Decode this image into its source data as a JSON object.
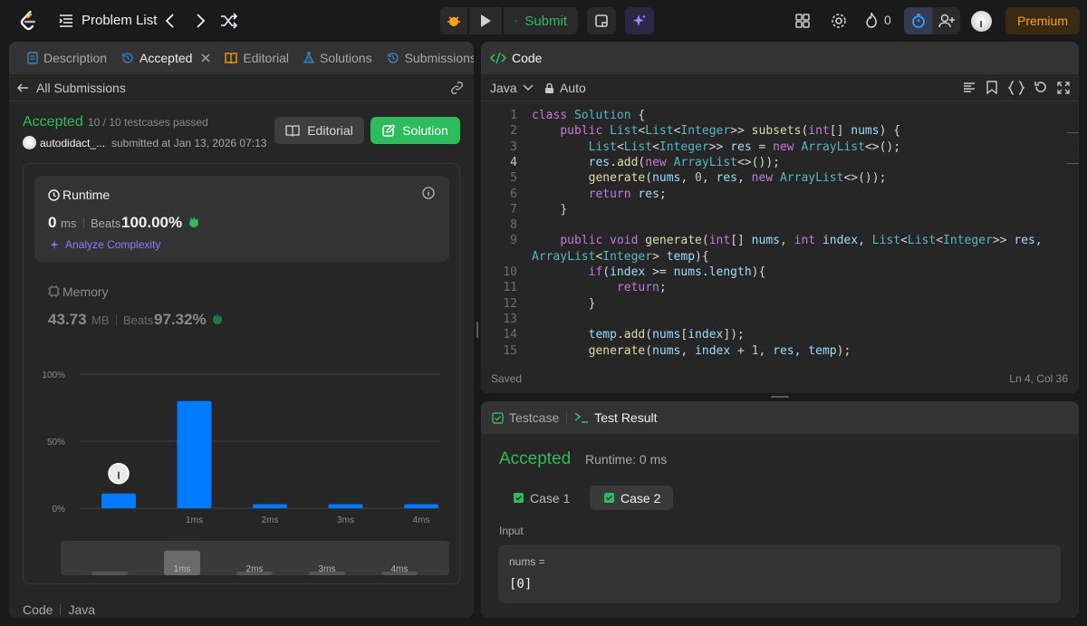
{
  "topbar": {
    "problem_list_label": "Problem List",
    "submit_label": "Submit",
    "streak_count": "0",
    "premium_label": "Premium"
  },
  "left_panel": {
    "tabs": [
      {
        "label": "Description",
        "icon": "description-icon"
      },
      {
        "label": "Accepted",
        "icon": "history-icon"
      },
      {
        "label": "Editorial",
        "icon": "book-icon"
      },
      {
        "label": "Solutions",
        "icon": "flask-icon"
      },
      {
        "label": "Submissions",
        "icon": "history-icon"
      }
    ],
    "back_label": "All Submissions",
    "status": "Accepted",
    "testcases": "10 / 10 testcases passed",
    "username": "autodidact_...",
    "submitted_text": "submitted at Jan 13, 2026 07:13",
    "editorial_button": "Editorial",
    "solution_button": "Solution",
    "runtime": {
      "title": "Runtime",
      "value": "0",
      "unit": "ms",
      "beats_label": "Beats",
      "beats_value": "100.00%",
      "analyze_label": "Analyze Complexity"
    },
    "memory": {
      "title": "Memory",
      "value": "43.73",
      "unit": "MB",
      "beats_label": "Beats",
      "beats_value": "97.32%"
    },
    "footer": {
      "code_label": "Code",
      "lang_label": "Java"
    }
  },
  "chart_data": {
    "type": "bar",
    "categories": [
      "",
      "1ms",
      "2ms",
      "3ms",
      "4ms"
    ],
    "values": [
      11,
      80,
      3,
      3,
      3
    ],
    "ylim": [
      0,
      100
    ],
    "y_ticks": [
      "100%",
      "50%",
      "0%"
    ],
    "highlight_index": 0,
    "bar_color": "#007aff",
    "minimap_labels": [
      "1ms",
      "2ms",
      "3ms",
      "4ms"
    ]
  },
  "code_panel": {
    "title": "Code",
    "language": "Java",
    "mode": "Auto",
    "status": "Saved",
    "cursor": "Ln 4, Col 36",
    "lines": [
      {
        "n": "1",
        "code": "class Solution {"
      },
      {
        "n": "2",
        "code": "    public List<List<Integer>> subsets(int[] nums) {"
      },
      {
        "n": "3",
        "code": "        List<List<Integer>> res = new ArrayList<>();"
      },
      {
        "n": "4",
        "code": "        res.add(new ArrayList<>());"
      },
      {
        "n": "5",
        "code": "        generate(nums, 0, res, new ArrayList<>());"
      },
      {
        "n": "6",
        "code": "        return res;"
      },
      {
        "n": "7",
        "code": "    }"
      },
      {
        "n": "8",
        "code": ""
      },
      {
        "n": "9",
        "code": "    public void generate(int[] nums, int index, List<List<Integer>> res,"
      },
      {
        "n": "",
        "code": "ArrayList<Integer> temp){"
      },
      {
        "n": "10",
        "code": "        if(index >= nums.length){"
      },
      {
        "n": "11",
        "code": "            return;"
      },
      {
        "n": "12",
        "code": "        }"
      },
      {
        "n": "13",
        "code": ""
      },
      {
        "n": "14",
        "code": "        temp.add(nums[index]);"
      },
      {
        "n": "15",
        "code": "        generate(nums, index + 1, res, temp);"
      }
    ]
  },
  "result_panel": {
    "testcase_tab": "Testcase",
    "result_tab": "Test Result",
    "status": "Accepted",
    "runtime": "Runtime: 0 ms",
    "cases": [
      "Case 1",
      "Case 2"
    ],
    "input_label": "Input",
    "var_name": "nums =",
    "var_value": "[0]"
  },
  "colors": {
    "accent_green": "#2cbb5d",
    "brand_orange": "#ffa116",
    "blue": "#007aff",
    "bg": "#1a1a1a",
    "panel": "#262626"
  }
}
